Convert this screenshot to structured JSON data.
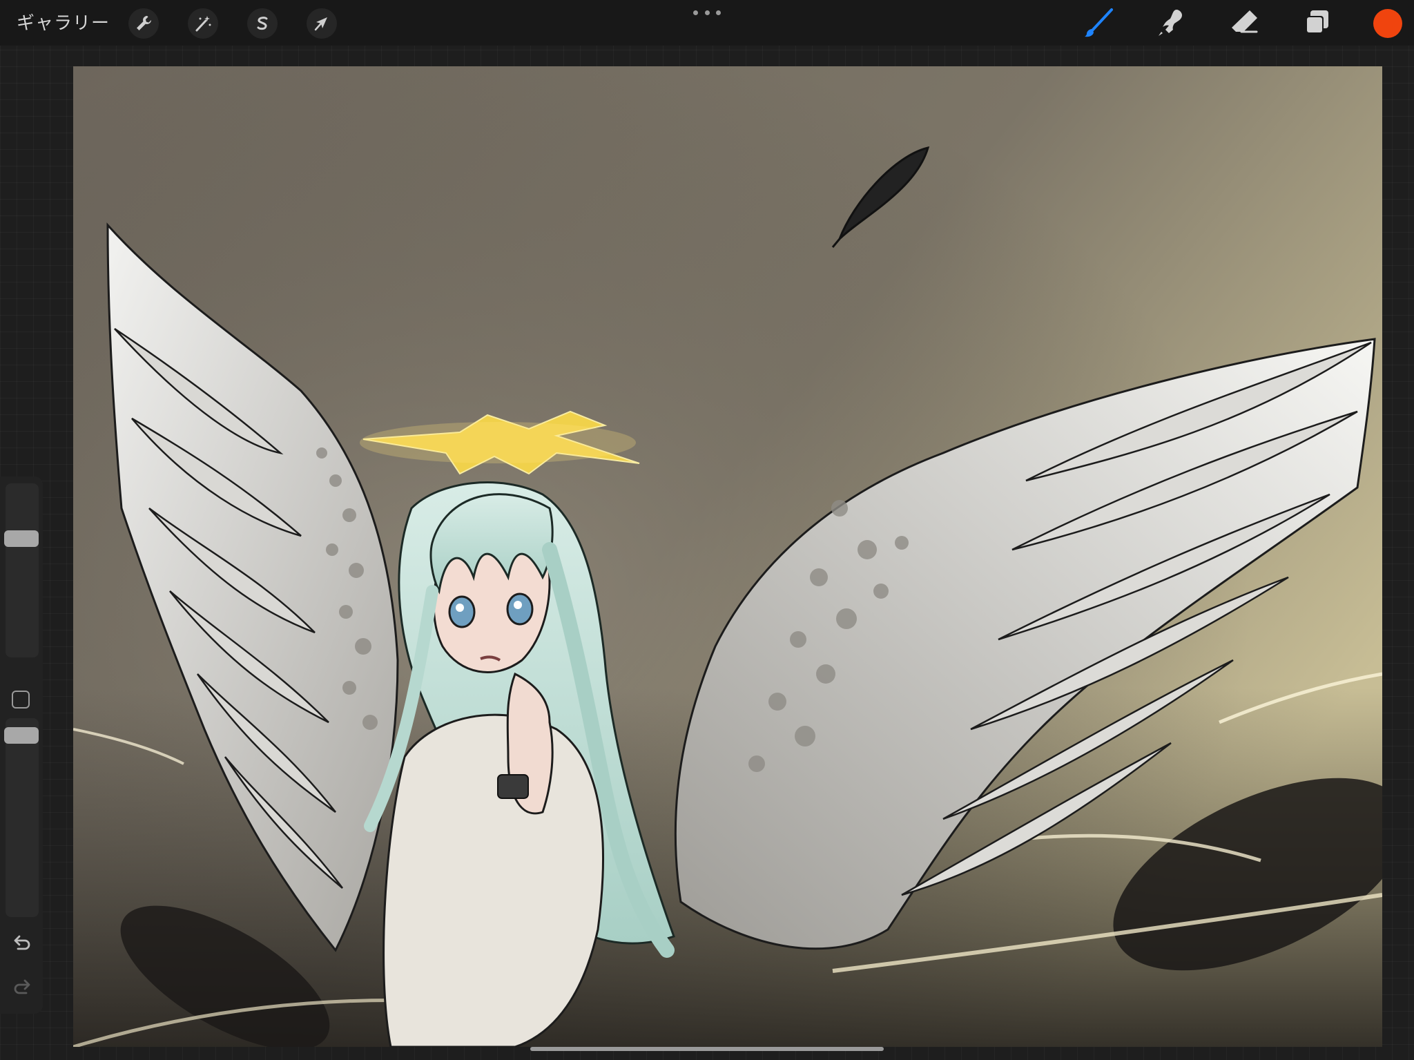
{
  "toolbar": {
    "gallery_label": "ギャラリー",
    "left_tools": [
      {
        "name": "actions",
        "icon": "wrench-icon"
      },
      {
        "name": "adjustments",
        "icon": "magic-wand-icon"
      },
      {
        "name": "selection",
        "icon": "selection-s-icon"
      },
      {
        "name": "transform",
        "icon": "arrow-cursor-icon"
      }
    ],
    "more_icon": "ellipsis-icon",
    "right_tools": [
      {
        "name": "brush",
        "icon": "brush-icon",
        "active": true
      },
      {
        "name": "smudge",
        "icon": "smudge-icon",
        "active": false
      },
      {
        "name": "eraser",
        "icon": "eraser-icon",
        "active": false
      },
      {
        "name": "layers",
        "icon": "layers-icon",
        "active": false
      }
    ],
    "current_color": "#f0440e",
    "active_tool_color": "#1e84ff"
  },
  "sidebar": {
    "brush_size": 0.7,
    "opacity": 0.95,
    "undo_icon": "undo-icon",
    "redo_icon": "redo-icon",
    "modify_icon": "square-icon"
  },
  "canvas": {
    "artwork": "angel-illustration"
  }
}
